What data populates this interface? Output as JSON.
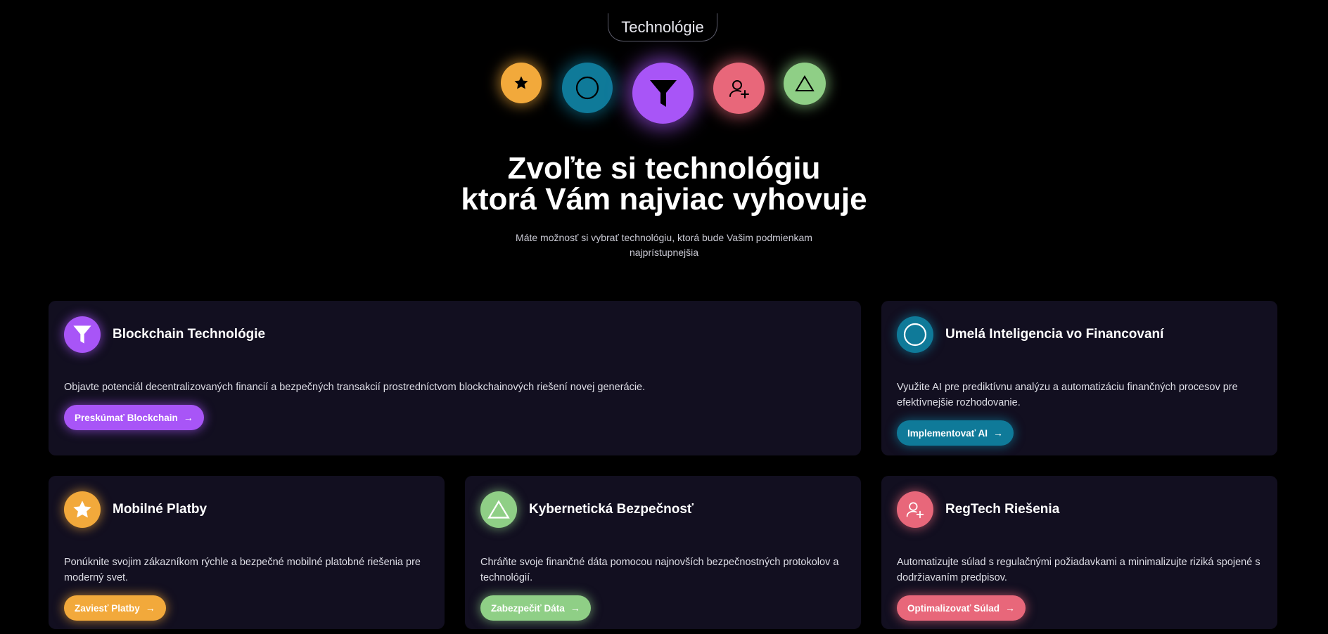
{
  "header": {
    "pill_label": "Technológie",
    "title_line1": "Zvoľte si technológiu",
    "title_line2": "ktorá Vám najviac vyhovuje",
    "subtitle": "Máte možnosť si vybrať technológiu, ktorá bude Vašim podmienkam najprístupnejšia"
  },
  "orbs": [
    {
      "icon": "star-icon",
      "color": "#f2a93b"
    },
    {
      "icon": "circle-icon",
      "color": "#0f7a99"
    },
    {
      "icon": "filter-icon",
      "color": "#a855f7"
    },
    {
      "icon": "user-plus-icon",
      "color": "#e8677a"
    },
    {
      "icon": "triangle-icon",
      "color": "#8fcf86"
    }
  ],
  "cards": {
    "blockchain": {
      "title": "Blockchain Technológie",
      "description": "Objavte potenciál decentralizovaných financií a bezpečných transakcií prostredníctvom blockchainových riešení novej generácie.",
      "button": "Preskúmať Blockchain",
      "icon": "filter-icon",
      "color": "#a855f7"
    },
    "ai": {
      "title": "Umelá Inteligencia vo Financovaní",
      "description": "Využite AI pre prediktívnu analýzu a automatizáciu finančných procesov pre efektívnejšie rozhodovanie.",
      "button": "Implementovať AI",
      "icon": "circle-icon",
      "color": "#0f7a99"
    },
    "mobile": {
      "title": "Mobilné Platby",
      "description": "Ponúknite svojim zákazníkom rýchle a bezpečné mobilné platobné riešenia pre moderný svet.",
      "button": "Zaviesť Platby",
      "icon": "star-icon",
      "color": "#f2a93b"
    },
    "security": {
      "title": "Kybernetická Bezpečnosť",
      "description": "Chráňte svoje finančné dáta pomocou najnovších bezpečnostných protokolov a technológií.",
      "button": "Zabezpečiť Dáta",
      "icon": "triangle-icon",
      "color": "#8fcf86"
    },
    "regtech": {
      "title": "RegTech Riešenia",
      "description": "Automatizujte súlad s regulačnými požiadavkami a minimalizujte riziká spojené s dodržiavaním predpisov.",
      "button": "Optimalizovať Súlad",
      "icon": "user-plus-icon",
      "color": "#e8677a"
    }
  },
  "button_arrow": "→"
}
